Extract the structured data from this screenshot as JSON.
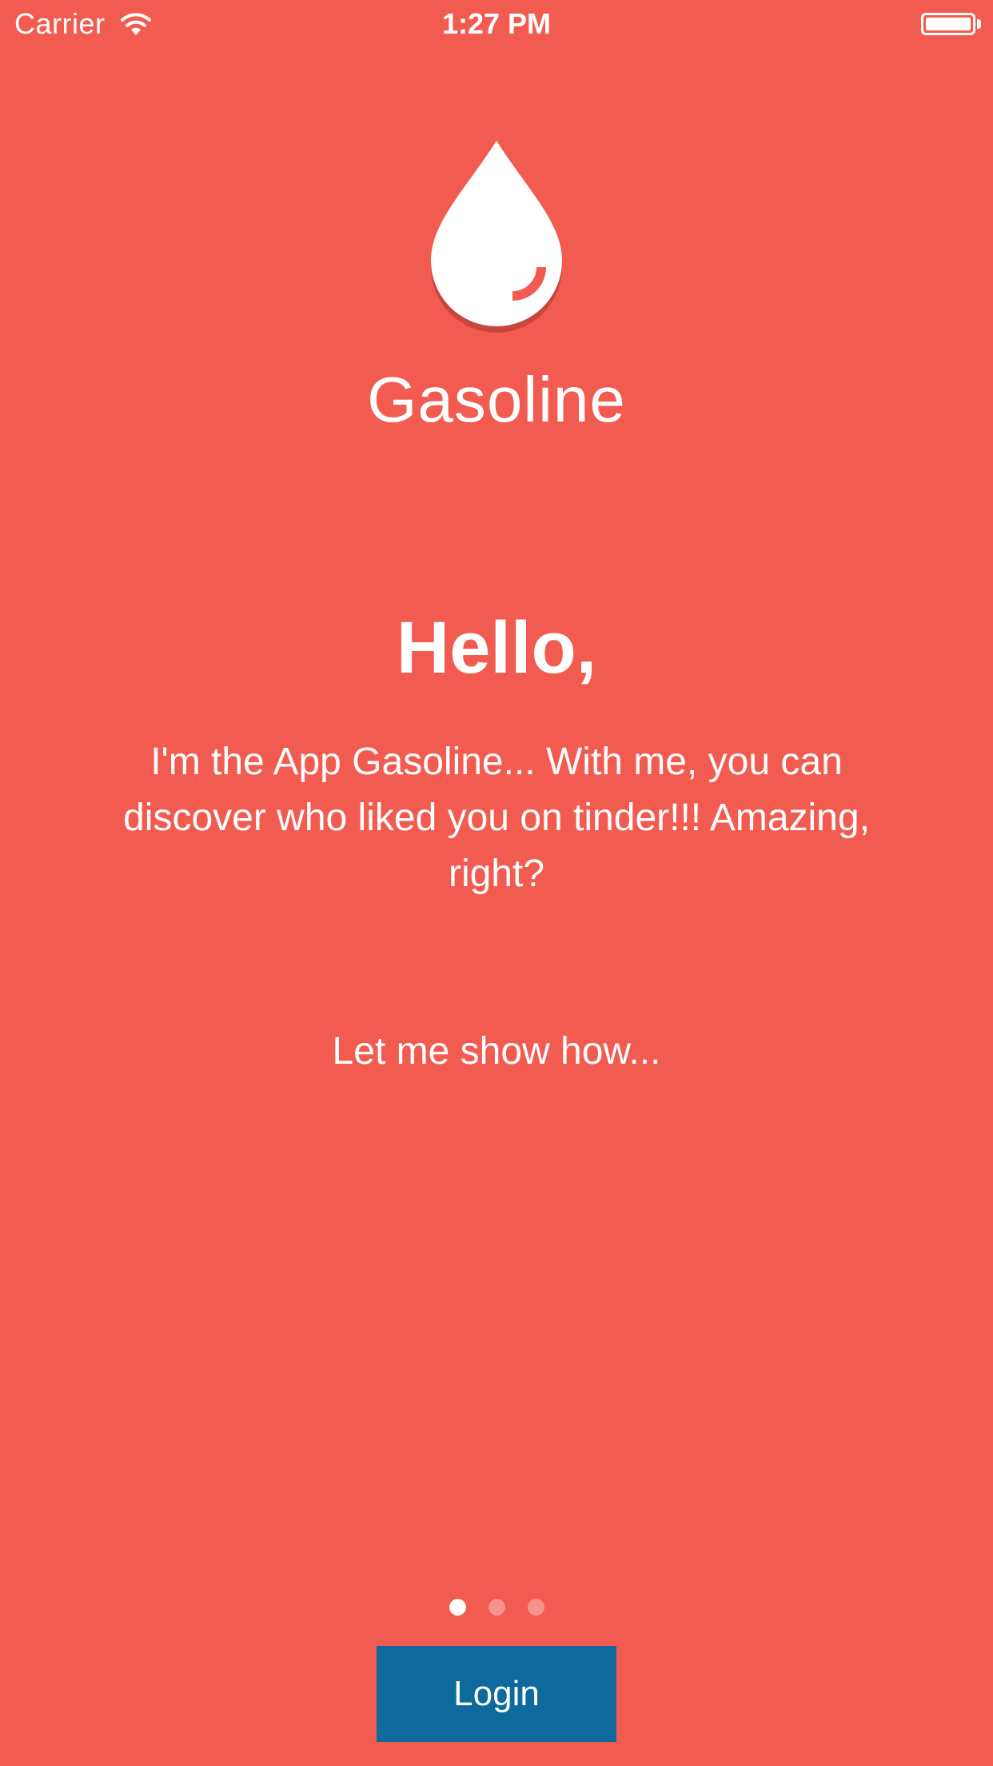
{
  "status_bar": {
    "carrier": "Carrier",
    "time": "1:27 PM",
    "wifi_icon": "wifi-icon",
    "battery_icon": "battery-icon"
  },
  "branding": {
    "logo_icon": "gas-drop-icon",
    "app_name": "Gasoline"
  },
  "onboarding": {
    "greeting": "Hello,",
    "intro": "I'm the App Gasoline... With me, you can discover who liked you on tinder!!! Amazing, right?",
    "tease": "Let me show how...",
    "page_count": 3,
    "current_page": 1
  },
  "actions": {
    "login_label": "Login"
  },
  "colors": {
    "background": "#F25B4F",
    "button": "#0E6A9B",
    "text": "#FFFFFF",
    "logo_shadow": "#C9463C"
  }
}
